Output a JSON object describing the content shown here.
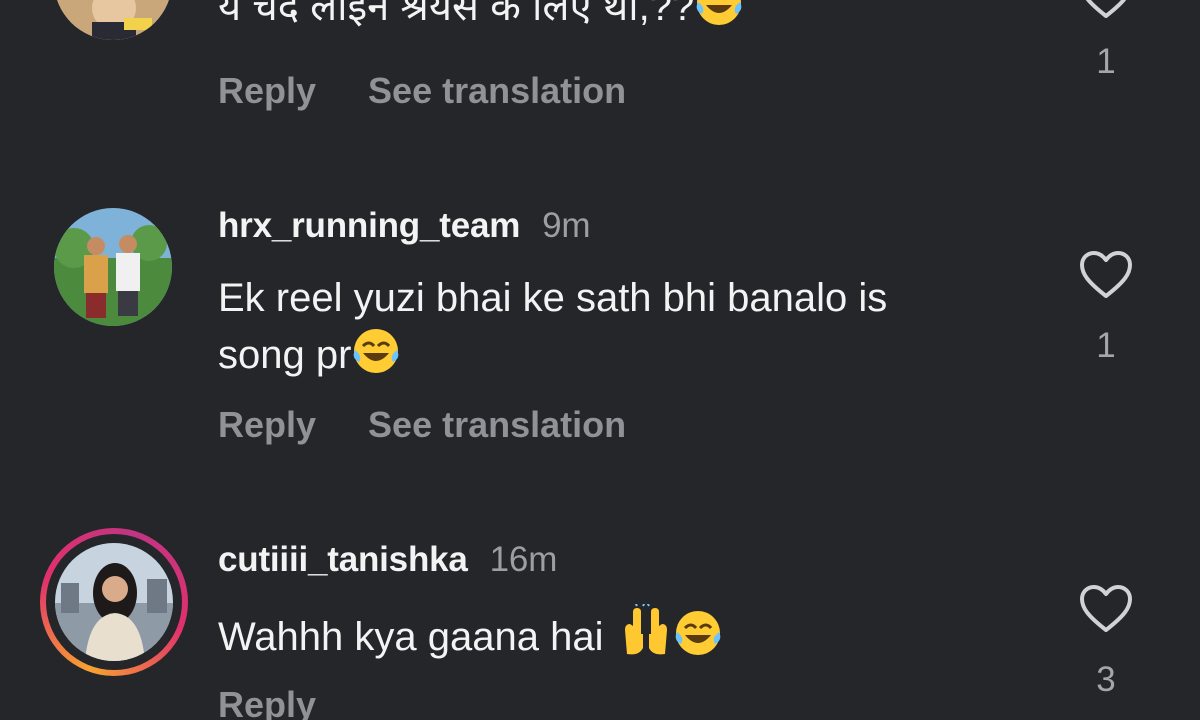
{
  "comments": [
    {
      "username": "",
      "time": "",
      "text": "ये चंद लाइन श्रेयस के लिए था,??",
      "emoji": "😂",
      "actions": {
        "reply": "Reply",
        "translate": "See translation"
      },
      "likes": "1"
    },
    {
      "username": "hrx_running_team",
      "time": "9m",
      "text_line1": "Ek reel yuzi bhai ke sath bhi banalo is",
      "text_line2": "song pr",
      "emoji": "😂",
      "actions": {
        "reply": "Reply",
        "translate": "See translation"
      },
      "likes": "1"
    },
    {
      "username": "cutiiii_tanishka",
      "time": "16m",
      "text": "Wahhh kya gaana hai",
      "emoji1": "🙌",
      "emoji2": "😂",
      "actions": {
        "reply": "Reply"
      },
      "likes": "3"
    }
  ],
  "colors": {
    "background": "#24262a",
    "text": "#f3f3f3",
    "muted": "#8f9297",
    "story_ring_start": "#f7a331",
    "story_ring_end": "#c13584"
  },
  "icons": [
    "heart-outline-icon",
    "face-with-tears-of-joy-emoji",
    "raised-hands-emoji"
  ]
}
